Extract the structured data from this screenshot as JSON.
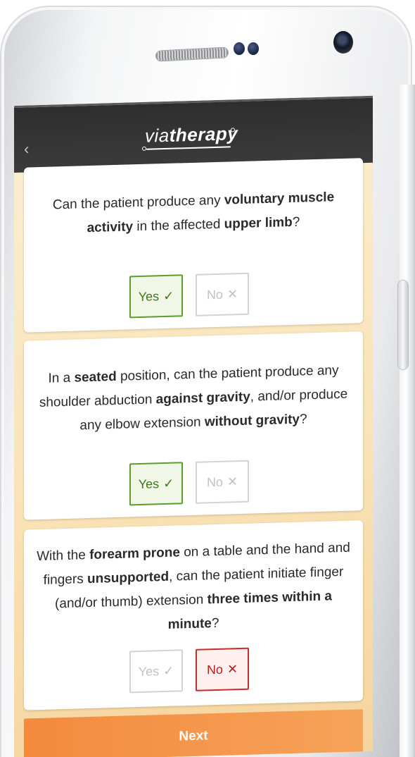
{
  "app": {
    "logo_prefix": "via",
    "logo_suffix": "therapy",
    "back_glyph": "‹"
  },
  "questions": [
    {
      "text_parts": [
        "Can the patient produce any ",
        "voluntary muscle activity",
        " in the affected ",
        "upper limb",
        "?"
      ],
      "yes_label": "Yes",
      "no_label": "No",
      "selected": "yes"
    },
    {
      "text_parts": [
        "In a ",
        "seated",
        " position, can the patient produce any shoulder abduction ",
        "against gravity",
        ", and/or produce any elbow extension ",
        "without gravity",
        "?"
      ],
      "yes_label": "Yes",
      "no_label": "No",
      "selected": "yes"
    },
    {
      "text_parts": [
        "With the ",
        "forearm prone",
        " on a table and the hand and fingers ",
        "unsupported",
        ", can the patient initiate finger (and/or thumb) extension ",
        "three times within a minute",
        "?"
      ],
      "yes_label": "Yes",
      "no_label": "No",
      "selected": "no"
    }
  ],
  "icons": {
    "yes_mark": "✓",
    "no_mark": "✕"
  },
  "next_label": "Next",
  "colors": {
    "header": "#333333",
    "yes_selected": "#5b9e2a",
    "no_selected": "#cc2b2b",
    "next_button": "#f38a3d",
    "screen_background": "#f9e3b7"
  }
}
